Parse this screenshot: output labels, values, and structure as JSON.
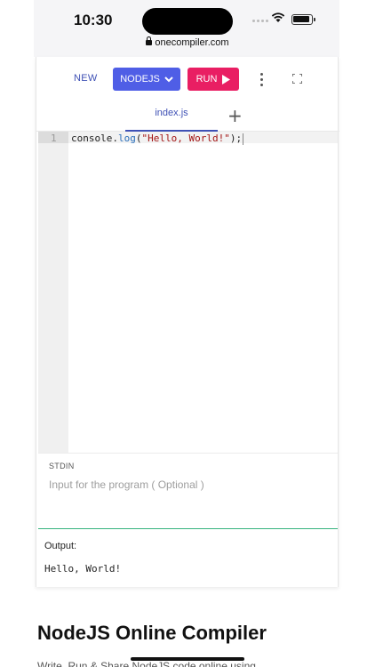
{
  "status": {
    "time": "10:30",
    "url": "onecompiler.com"
  },
  "toolbar": {
    "new_label": "NEW",
    "language_label": "NODEJS",
    "run_label": "RUN"
  },
  "tabs": [
    {
      "label": "index.js"
    }
  ],
  "editor": {
    "line_number": "1",
    "code": {
      "part1": "console.",
      "fn": "log",
      "part2": "(",
      "str": "\"Hello, World!\"",
      "part3": ");"
    }
  },
  "stdin": {
    "label": "STDIN",
    "placeholder": "Input for the program ( Optional )"
  },
  "output": {
    "label": "Output:",
    "text": "Hello, World!"
  },
  "page": {
    "heading": "NodeJS Online Compiler",
    "subtext": "Write, Run & Share NodeJS code online using"
  },
  "colors": {
    "accent": "#4f5ee6",
    "run": "#e91e63",
    "link": "#3f51b5"
  }
}
